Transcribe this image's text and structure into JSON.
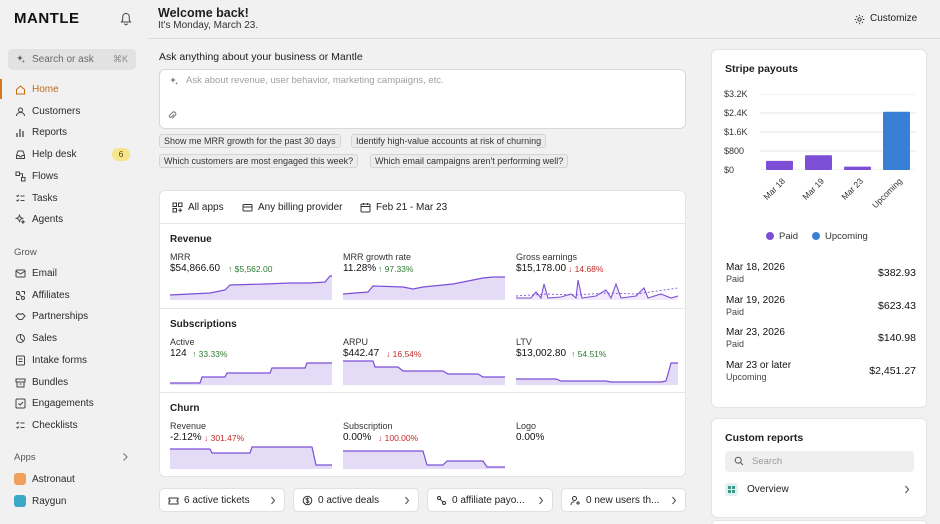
{
  "sidebar": {
    "logo": "MANTLE",
    "search": {
      "label": "Search or ask",
      "shortcut": "⌘K"
    },
    "nav": [
      {
        "label": "Home",
        "icon": "home-icon",
        "active": true
      },
      {
        "label": "Customers",
        "icon": "users-icon"
      },
      {
        "label": "Reports",
        "icon": "bar-chart-icon"
      },
      {
        "label": "Help desk",
        "icon": "inbox-icon",
        "badge": "6"
      },
      {
        "label": "Flows",
        "icon": "flow-icon"
      },
      {
        "label": "Tasks",
        "icon": "checklist-icon"
      },
      {
        "label": "Agents",
        "icon": "sparkle-icon"
      }
    ],
    "grow_label": "Grow",
    "grow": [
      {
        "label": "Email",
        "icon": "mail-icon"
      },
      {
        "label": "Affiliates",
        "icon": "affiliates-icon"
      },
      {
        "label": "Partnerships",
        "icon": "handshake-icon"
      },
      {
        "label": "Sales",
        "icon": "sales-icon"
      },
      {
        "label": "Intake forms",
        "icon": "form-icon"
      },
      {
        "label": "Bundles",
        "icon": "bundle-icon"
      },
      {
        "label": "Engagements",
        "icon": "engagement-icon"
      },
      {
        "label": "Checklists",
        "icon": "checklist-icon"
      }
    ],
    "apps_label": "Apps",
    "apps": [
      {
        "label": "Astronaut",
        "color": "#f0a05a"
      },
      {
        "label": "Raygun",
        "color": "#3aa6c8"
      }
    ]
  },
  "header": {
    "welcome": "Welcome back!",
    "date": "It's Monday, March 23.",
    "customize": "Customize"
  },
  "ask": {
    "title": "Ask anything about your business or Mantle",
    "placeholder": "Ask about revenue, user behavior, marketing campaigns, etc.",
    "suggestions": [
      "Show me MRR growth for the past 30 days",
      "Identify high-value accounts at risk of churning",
      "Which customers are most engaged this week?",
      "Which email campaigns aren't performing well?"
    ]
  },
  "filters": {
    "apps": "All apps",
    "billing": "Any billing provider",
    "date_range": "Feb 21 - Mar 23"
  },
  "metrics": {
    "revenue_title": "Revenue",
    "subscriptions_title": "Subscriptions",
    "churn_title": "Churn",
    "mrr": {
      "name": "MRR",
      "value": "$54,866.60",
      "change": "$5,562.00",
      "dir": "up"
    },
    "mrr_growth": {
      "name": "MRR growth rate",
      "value": "11.28%",
      "change": "97.33%",
      "dir": "up"
    },
    "gross": {
      "name": "Gross earnings",
      "value": "$15,178.00",
      "change": "14.68%",
      "dir": "down"
    },
    "active": {
      "name": "Active",
      "value": "124",
      "change": "33.33%",
      "dir": "up"
    },
    "arpu": {
      "name": "ARPU",
      "value": "$442.47",
      "change": "16.54%",
      "dir": "down"
    },
    "ltv": {
      "name": "LTV",
      "value": "$13,002.80",
      "change": "54.51%",
      "dir": "up"
    },
    "churn_rev": {
      "name": "Revenue",
      "value": "-2.12%",
      "change": "301.47%",
      "dir": "down"
    },
    "churn_sub": {
      "name": "Subscription",
      "value": "0.00%",
      "change": "100.00%",
      "dir": "down"
    },
    "churn_logo": {
      "name": "Logo",
      "value": "0.00%"
    }
  },
  "pills": [
    {
      "label": "6 active tickets",
      "icon": "ticket-icon"
    },
    {
      "label": "0 active deals",
      "icon": "dollar-icon"
    },
    {
      "label": "0 affiliate payo...",
      "icon": "affiliates-icon"
    },
    {
      "label": "0 new users th...",
      "icon": "add-user-icon"
    }
  ],
  "stripe": {
    "title": "Stripe payouts",
    "legend": [
      {
        "label": "Paid",
        "color": "#7c4fd6"
      },
      {
        "label": "Upcoming",
        "color": "#3a7fd6"
      }
    ],
    "payouts": [
      {
        "date": "Mar 18, 2026",
        "status": "Paid",
        "amount": "$382.93"
      },
      {
        "date": "Mar 19, 2026",
        "status": "Paid",
        "amount": "$623.43"
      },
      {
        "date": "Mar 23, 2026",
        "status": "Paid",
        "amount": "$140.98"
      },
      {
        "date": "Mar 23 or later",
        "status": "Upcoming",
        "amount": "$2,451.27"
      }
    ]
  },
  "chart_data": {
    "type": "bar",
    "title": "Stripe payouts",
    "categories": [
      "Mar 18",
      "Mar 19",
      "Mar 23",
      "Upcoming"
    ],
    "yticks": [
      "$3.2K",
      "$2.4K",
      "$1.6K",
      "$800",
      "$0"
    ],
    "ylim": [
      0,
      3200
    ],
    "series": [
      {
        "name": "Paid",
        "values": [
          382.93,
          623.43,
          140.98,
          null
        ]
      },
      {
        "name": "Upcoming",
        "values": [
          null,
          null,
          null,
          2451.27
        ]
      }
    ],
    "legend": "bottom"
  },
  "reports": {
    "title": "Custom reports",
    "search_placeholder": "Search",
    "items": [
      {
        "label": "Overview"
      }
    ]
  }
}
